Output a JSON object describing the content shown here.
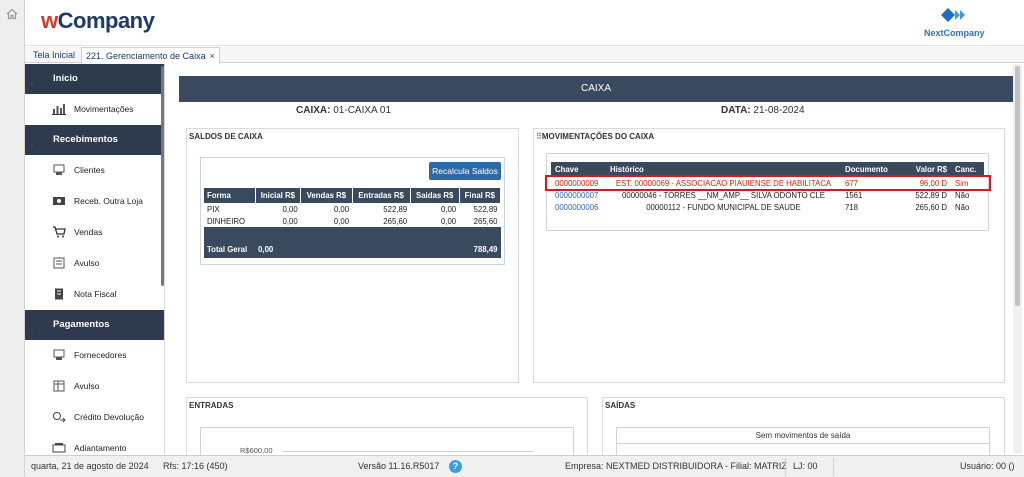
{
  "header": {
    "logo_w": "w",
    "logo_rest": "Company",
    "partner_logo": "NextCompany"
  },
  "tabs": [
    {
      "label": "Tela Inicial"
    },
    {
      "label": "221. Gerenciamento de Caixa",
      "close": "×"
    }
  ],
  "sidebar": {
    "sections": [
      {
        "label": "Início",
        "items": [
          {
            "label": "Movimentações",
            "icon": "chart-icon"
          }
        ]
      },
      {
        "label": "Recebimentos",
        "items": [
          {
            "label": "Clientes",
            "icon": "clients-icon"
          },
          {
            "label": "Receb. Outra Loja",
            "icon": "cash-icon"
          },
          {
            "label": "Vendas",
            "icon": "cart-icon"
          },
          {
            "label": "Avulso",
            "icon": "document-icon"
          },
          {
            "label": "Nota Fiscal",
            "icon": "invoice-icon"
          }
        ]
      },
      {
        "label": "Pagamentos",
        "items": [
          {
            "label": "Fornecedores",
            "icon": "supplier-icon"
          },
          {
            "label": "Avulso",
            "icon": "ledger-icon"
          },
          {
            "label": "Crédito Devolução",
            "icon": "refund-icon"
          },
          {
            "label": "Adiantamento",
            "icon": "advance-icon"
          }
        ]
      }
    ]
  },
  "main": {
    "title": "CAIXA",
    "caixa_label": "CAIXA:",
    "caixa_value": "01-CAIXA 01",
    "data_label": "DATA:",
    "data_value": "21-08-2024",
    "saldos": {
      "title": "SALDOS DE CAIXA",
      "recalc_button": "Recalcula Saldos",
      "headers": [
        "Forma",
        "Inicial R$",
        "Vendas R$",
        "Entradas R$",
        "Saidas R$",
        "Final R$"
      ],
      "rows": [
        [
          "PIX",
          "0,00",
          "0,00",
          "522,89",
          "0,00",
          "522,89"
        ],
        [
          "DINHEIRO",
          "0,00",
          "0,00",
          "265,60",
          "0,00",
          "265,60"
        ]
      ],
      "total_label": "Total Geral",
      "total_initial": "0,00",
      "total_final": "788,49"
    },
    "movimentacoes": {
      "title": "MOVIMENTAÇÕES DO CAIXA",
      "headers": [
        "Chave",
        "Histórico",
        "Documento",
        "Valor R$",
        "Canc."
      ],
      "rows": [
        {
          "chave": "0000000009",
          "historico": "EST. 00000069 - ASSOCIACAO PIAUIENSE DE HABILITACA",
          "documento": "677",
          "valor": "96,00 D",
          "canc": "Sim",
          "cancelled": true
        },
        {
          "chave": "0000000007",
          "historico": "00000046 - TORRES __NM_AMP__ SILVA ODONTO CLE",
          "documento": "1561",
          "valor": "522,89 D",
          "canc": "Não",
          "cancelled": false
        },
        {
          "chave": "0000000006",
          "historico": "00000112 - FUNDO MUNICIPAL DE SAUDE",
          "documento": "718",
          "valor": "265,60 D",
          "canc": "Não",
          "cancelled": false
        }
      ]
    },
    "entradas": {
      "title": "ENTRADAS",
      "ytick": "R$600,00"
    },
    "saidas": {
      "title": "SAÍDAS",
      "empty": "Sem movimentos de saída"
    }
  },
  "status": {
    "date": "quarta, 21 de agosto de 2024",
    "rfs": "Rfs: 17:16 (450)",
    "version": "Versão 11.16.R5017",
    "help": "?",
    "empresa": "Empresa: NEXTMED DISTRIBUIDORA - Filial: MATRIZ",
    "lj": "LJ: 00",
    "usuario": "Usuário: 00 ()"
  },
  "colors": {
    "navy": "#3a4a5e",
    "accent_blue": "#2e6aa7",
    "highlight_red": "#d41a1a"
  }
}
